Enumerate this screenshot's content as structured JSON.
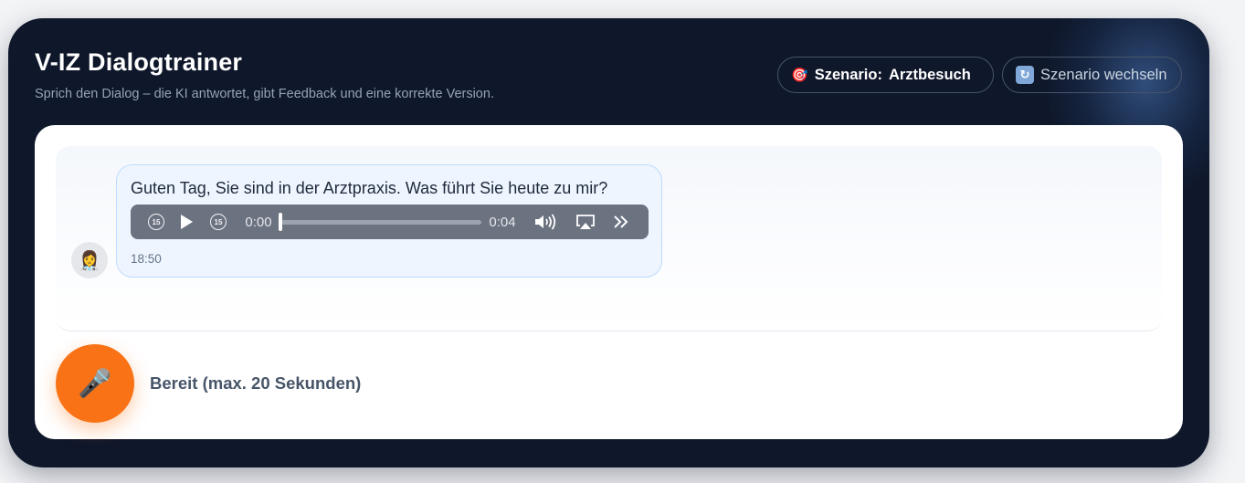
{
  "header": {
    "title": "V-IZ Dialogtrainer",
    "subtitle": "Sprich den Dialog – die KI antwortet, gibt Feedback und eine korrekte Version."
  },
  "scenario": {
    "icon": "target-icon",
    "label": "Szenario:",
    "value": "Arztbesuch"
  },
  "switch_button": {
    "icon": "refresh-icon",
    "label": "Szenario wechseln"
  },
  "chat": {
    "messages": [
      {
        "avatar_icon": "doctor-avatar-icon",
        "text": "Guten Tag, Sie sind in der Arztpraxis. Was führt Sie heute zu mir?",
        "timestamp": "18:50",
        "audio": {
          "current_time": "0:00",
          "duration": "0:04",
          "progress": 0.0,
          "skip_back_label": "15",
          "skip_forward_label": "15"
        }
      }
    ]
  },
  "recorder": {
    "icon": "microphone-icon",
    "status": "Bereit (max. 20 Sekunden)"
  },
  "colors": {
    "background": "#0f172a",
    "accent": "#f97316",
    "bubble": "#eef5fe"
  }
}
